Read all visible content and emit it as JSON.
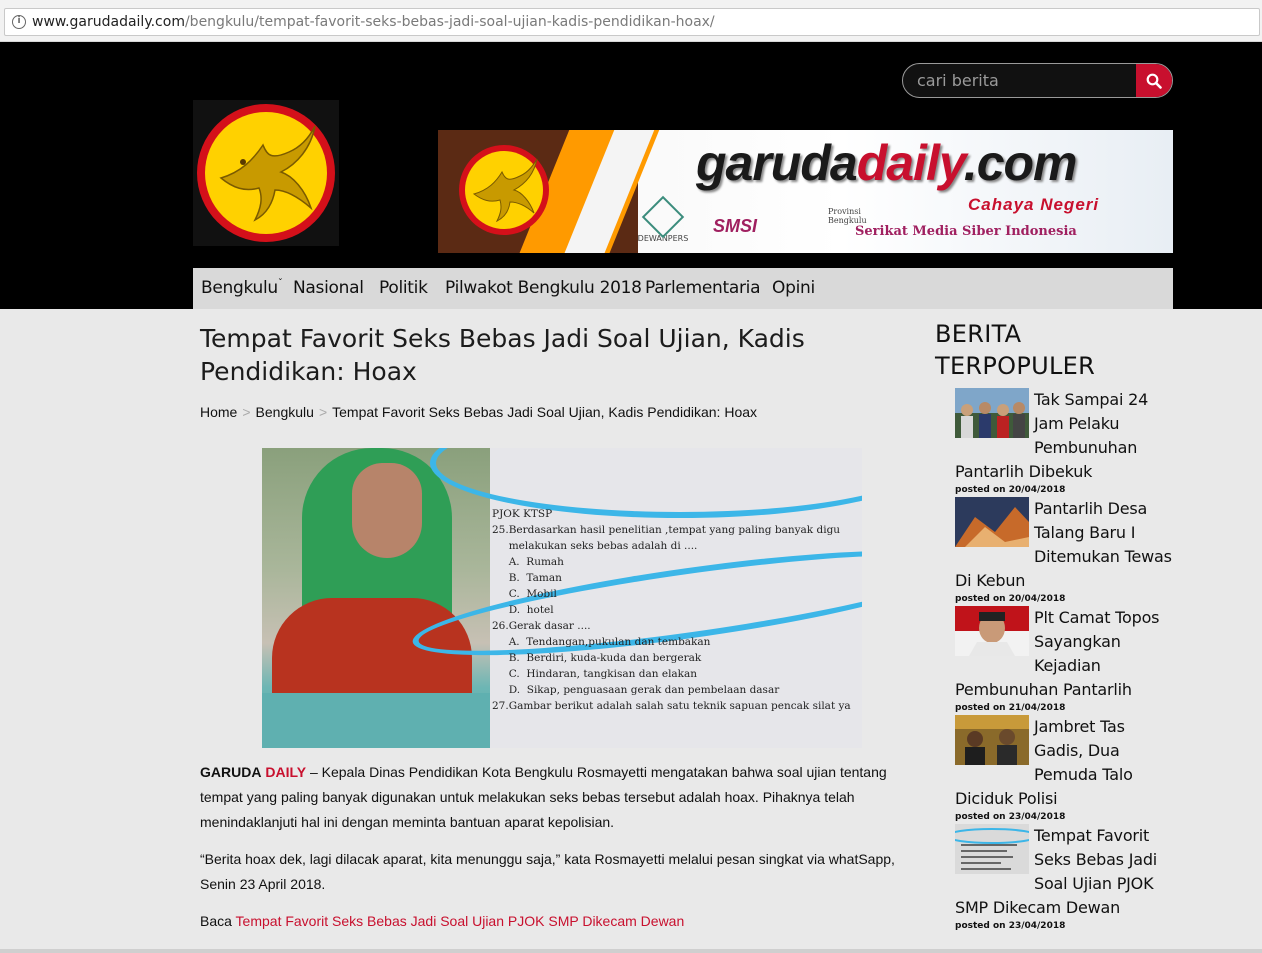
{
  "browser": {
    "url_domain": "www.garudadaily.com",
    "url_path": "/bengkulu/tempat-favorit-seks-bebas-jadi-soal-ujian-kadis-pendidikan-hoax/"
  },
  "header": {
    "search_placeholder": "cari berita",
    "banner": {
      "title_dark": "garuda",
      "title_red": "daily",
      "title_suffix": ".com",
      "tagline": "Cahaya Negeri",
      "logo1": "DEWANPERS",
      "logo2": "SMSI",
      "logo3_sub": "Provinsi Bengkulu",
      "logo3": "Serikat Media Siber Indonesia"
    }
  },
  "nav": {
    "items": [
      {
        "label": "Bengkulu",
        "caret": "ˇ"
      },
      {
        "label": "Nasional"
      },
      {
        "label": "Politik"
      },
      {
        "label": "Pilwakot Bengkulu 2018"
      },
      {
        "label": "Parlementaria"
      },
      {
        "label": "Opini"
      }
    ]
  },
  "article": {
    "title": "Tempat Favorit Seks Bebas Jadi Soal Ujian, Kadis Pendidikan: Hoax",
    "breadcrumb": [
      "Home",
      "Bengkulu",
      "Tempat Favorit Seks Bebas Jadi Soal Ujian, Kadis Pendidikan: Hoax"
    ],
    "breadcrumb_sep": ">",
    "photo_text": "PJOK KTSP\n25.Berdasarkan hasil penelitian ,tempat yang paling banyak digu\n     melakukan seks bebas adalah di ....\n     A.  Rumah\n     B.  Taman\n     C.  Mobil\n     D.  hotel\n26.Gerak dasar ....\n     A.  Tendangan,pukulan dan tembakan\n     B.  Berdiri, kuda-kuda dan bergerak\n     C.  Hindaran, tangkisan dan elakan\n     D.  Sikap, penguasaan gerak dan pembelaan dasar\n27.Gambar berikut adalah salah satu teknik sapuan pencak silat ya",
    "brand_a": "GARUDA",
    "brand_b": "DAILY",
    "p1": " – Kepala Dinas Pendidikan Kota Bengkulu Rosmayetti mengatakan bahwa soal ujian tentang tempat yang paling banyak digunakan untuk melakukan seks bebas tersebut adalah hoax. Pihaknya telah menindaklanjuti hal ini dengan meminta bantuan aparat kepolisian.",
    "p2": "“Berita hoax dek, lagi dilacak aparat, kita menunggu saja,” kata Rosmayetti melalui pesan singkat via whatSapp, Senin 23 April 2018.",
    "p3_prefix": "Baca ",
    "p3_link": "Tempat Favorit Seks Bebas Jadi Soal Ujian PJOK SMP Dikecam Dewan"
  },
  "sidebar": {
    "title": "BERITA TERPOPULER",
    "items": [
      {
        "title": "Tak Sampai 24 Jam Pelaku Pembunuhan Pantarlih Dibekuk",
        "date": "posted on 20/04/2018"
      },
      {
        "title": "Pantarlih Desa Talang Baru I Ditemukan Tewas Di Kebun",
        "date": "posted on 20/04/2018"
      },
      {
        "title": "Plt Camat Topos Sayangkan Kejadian Pembunuhan Pantarlih",
        "date": "posted on 21/04/2018"
      },
      {
        "title": "Jambret Tas Gadis, Dua Pemuda Talo Diciduk Polisi",
        "date": "posted on 23/04/2018"
      },
      {
        "title": "Tempat Favorit Seks Bebas Jadi Soal Ujian PJOK SMP Dikecam Dewan",
        "date": "posted on 23/04/2018"
      }
    ]
  },
  "colors": {
    "accent": "#c8102e",
    "header_bg": "#000000",
    "nav_bg": "#d9d9d9",
    "page_bg": "#e9e9e9"
  },
  "icons": [
    "info-icon",
    "search-icon",
    "garuda-logo",
    "chevron-down-icon"
  ]
}
